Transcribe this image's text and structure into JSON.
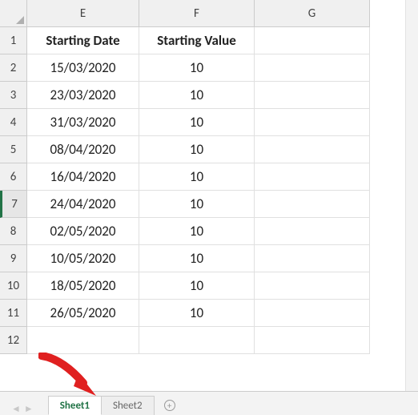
{
  "columns": [
    "E",
    "F",
    "G"
  ],
  "rows": [
    "1",
    "2",
    "3",
    "4",
    "5",
    "6",
    "7",
    "8",
    "9",
    "10",
    "11",
    "12"
  ],
  "selected_row": "7",
  "headers": {
    "E": "Starting Date",
    "F": "Starting Value"
  },
  "data": [
    {
      "date": "15/03/2020",
      "value": "10"
    },
    {
      "date": "23/03/2020",
      "value": "10"
    },
    {
      "date": "31/03/2020",
      "value": "10"
    },
    {
      "date": "08/04/2020",
      "value": "10"
    },
    {
      "date": "16/04/2020",
      "value": "10"
    },
    {
      "date": "24/04/2020",
      "value": "10"
    },
    {
      "date": "02/05/2020",
      "value": "10"
    },
    {
      "date": "10/05/2020",
      "value": "10"
    },
    {
      "date": "18/05/2020",
      "value": "10"
    },
    {
      "date": "26/05/2020",
      "value": "10"
    }
  ],
  "tabs": {
    "active": "Sheet1",
    "inactive": "Sheet2"
  }
}
